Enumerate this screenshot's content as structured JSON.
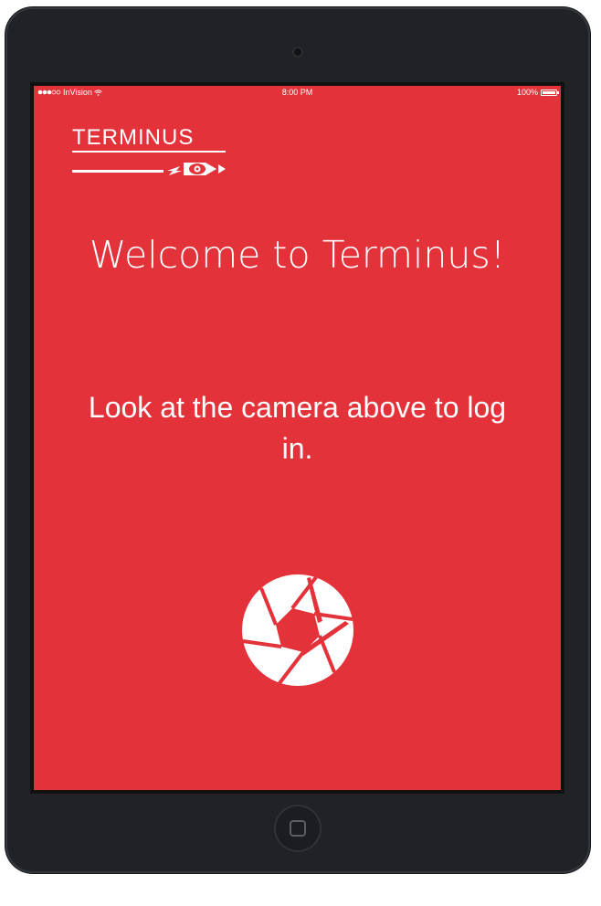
{
  "statusbar": {
    "carrier": "InVision",
    "time": "8:00 PM",
    "battery": "100%",
    "signal_icon": "signal-dots-icon",
    "wifi_icon": "wifi-icon",
    "battery_icon": "battery-icon",
    "battery_level": 1.0
  },
  "logo": {
    "text": "TERMINUS",
    "icon": "eye-logo-icon"
  },
  "main": {
    "welcome": "Welcome to Terminus!",
    "instruction": "Look at the camera above to log in.",
    "shutter_icon": "camera-shutter-icon"
  },
  "colors": {
    "background": "#e33239",
    "foreground": "#ffffff",
    "device_frame": "#202226"
  }
}
